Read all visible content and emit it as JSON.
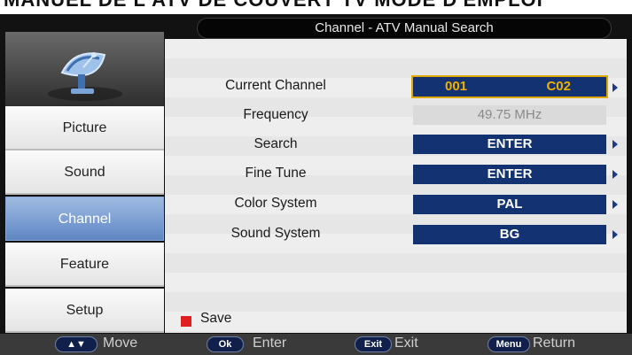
{
  "top_strip_text": "MANUEL DE L'ATV DE COUVERT TV MODE D'EMPLOI",
  "header": {
    "title": "Channel - ATV Manual Search"
  },
  "sidebar": {
    "items": [
      {
        "label": "Picture"
      },
      {
        "label": "Sound"
      },
      {
        "label": "Channel"
      },
      {
        "label": "Feature"
      },
      {
        "label": "Setup"
      }
    ],
    "active": "Channel"
  },
  "rows": [
    {
      "label": "Current Channel",
      "value_a": "001",
      "value_b": "C02"
    },
    {
      "label": "Frequency",
      "value": "49.75 MHz"
    },
    {
      "label": "Search",
      "value": "ENTER"
    },
    {
      "label": "Fine Tune",
      "value": "ENTER"
    },
    {
      "label": "Color System",
      "value": "PAL"
    },
    {
      "label": "Sound System",
      "value": "BG"
    }
  ],
  "save": {
    "label": "Save",
    "color": "#e02020"
  },
  "legend": [
    {
      "key": "▲▼",
      "label": "Move"
    },
    {
      "key": "Ok",
      "label": "Enter"
    },
    {
      "key": "Exit",
      "label": "Exit"
    },
    {
      "key": "Menu",
      "label": "Return"
    }
  ],
  "colors": {
    "value_box": "#123272",
    "active_menu": "#6f93cc",
    "highlight": "#e0a800"
  }
}
